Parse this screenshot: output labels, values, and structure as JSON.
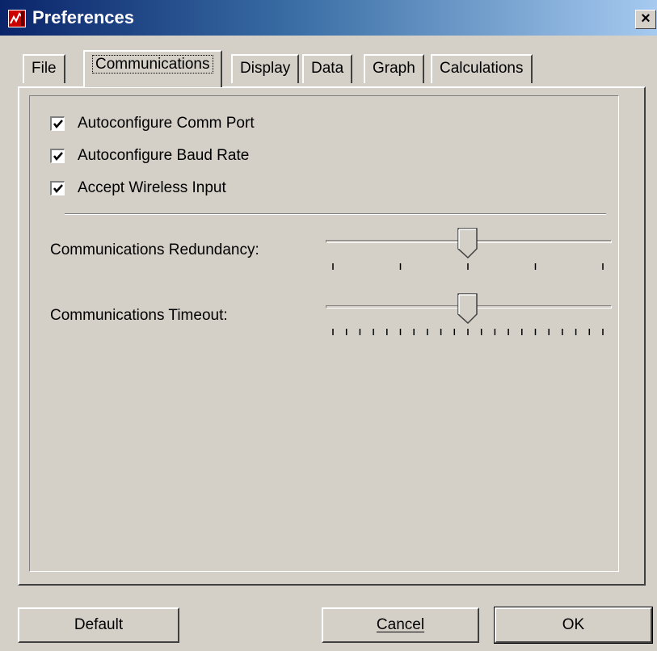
{
  "window": {
    "title": "Preferences",
    "icon": "app-chart-icon",
    "close_label": "×"
  },
  "tabs": [
    {
      "label": "File",
      "active": false
    },
    {
      "label": "Communications",
      "active": true
    },
    {
      "label": "Display",
      "active": false
    },
    {
      "label": "Data",
      "active": false
    },
    {
      "label": "Graph",
      "active": false
    },
    {
      "label": "Calculations",
      "active": false
    }
  ],
  "checkboxes": [
    {
      "label": "Autoconfigure Comm Port",
      "checked": true
    },
    {
      "label": "Autoconfigure Baud Rate",
      "checked": true
    },
    {
      "label": "Accept Wireless Input",
      "checked": true
    }
  ],
  "sliders": [
    {
      "label": "Communications Redundancy:",
      "tick_count": 5,
      "position": 0.5
    },
    {
      "label": "Communications Timeout:",
      "tick_count": 21,
      "position": 0.5
    }
  ],
  "buttons": {
    "default": "Default",
    "cancel": "Cancel",
    "ok": "OK"
  },
  "colors": {
    "face": "#d4d0c8",
    "title_start": "#0a246a",
    "title_end": "#a6caf0"
  }
}
